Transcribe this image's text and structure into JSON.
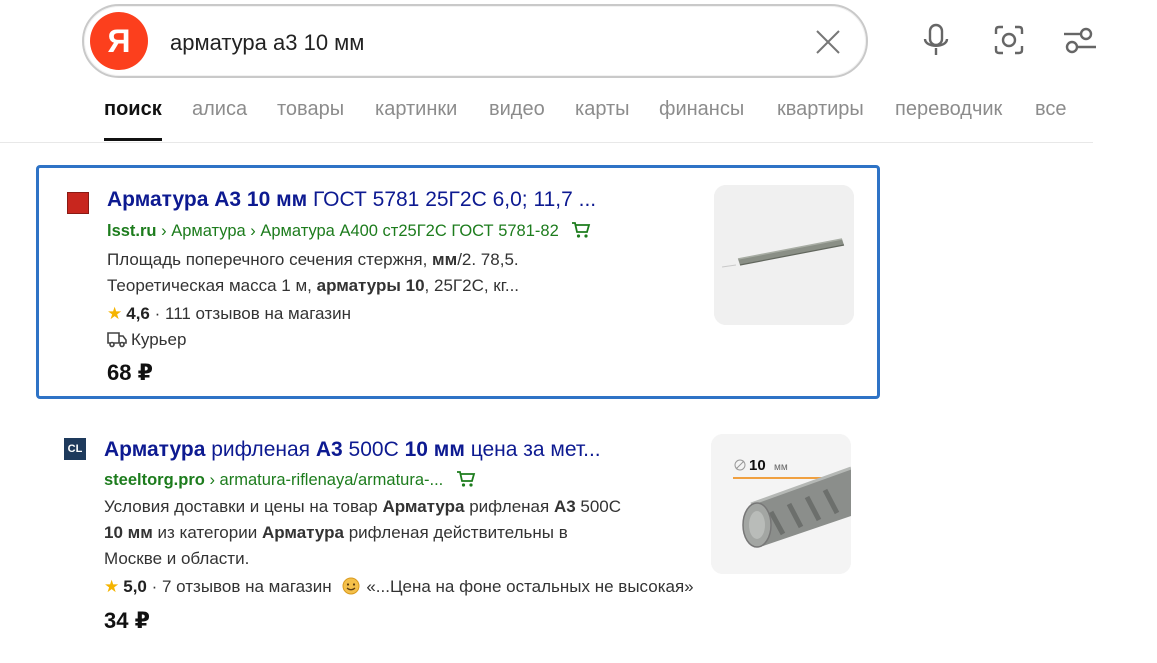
{
  "search": {
    "logo_letter": "Я",
    "query": "арматура а3 10 мм"
  },
  "tabs": [
    {
      "label": "поиск",
      "active": true
    },
    {
      "label": "алиса"
    },
    {
      "label": "товары"
    },
    {
      "label": "картинки"
    },
    {
      "label": "видео"
    },
    {
      "label": "карты"
    },
    {
      "label": "финансы"
    },
    {
      "label": "квартиры"
    },
    {
      "label": "переводчик"
    },
    {
      "label": "все"
    }
  ],
  "results": [
    {
      "title_parts": [
        {
          "text": "Арматура А3 10 мм",
          "bold": true
        },
        {
          "text": " ГОСТ 5781 25Г2С 6,0; 11,7 ...",
          "bold": false
        }
      ],
      "domain": "lsst.ru",
      "breadcrumbs": " › Арматура › Арматура А400 ст25Г2С ГОСТ 5781-82",
      "snippet_line1_parts": [
        {
          "text": "Площадь поперечного сечения стержня, ",
          "bold": false
        },
        {
          "text": "мм",
          "bold": true
        },
        {
          "text": "/2. 78,5.",
          "bold": false
        }
      ],
      "snippet_line2_parts": [
        {
          "text": "Теоретическая масса 1 м, ",
          "bold": false
        },
        {
          "text": "арматуры 10",
          "bold": true
        },
        {
          "text": ", 25Г2С, кг...",
          "bold": false
        }
      ],
      "rating": "4,6",
      "reviews": " · 111 отзывов на магазин",
      "delivery": "Курьер",
      "price": "68 ₽"
    },
    {
      "title_parts": [
        {
          "text": "Арматура",
          "bold": true
        },
        {
          "text": " рифленая ",
          "bold": false
        },
        {
          "text": "А3",
          "bold": true
        },
        {
          "text": " 500С ",
          "bold": false
        },
        {
          "text": "10 мм",
          "bold": true
        },
        {
          "text": " цена за мет...",
          "bold": false
        }
      ],
      "favicon_text": "CL",
      "domain": "steeltorg.pro",
      "breadcrumbs": " › armatura-riflenaya/armatura-...",
      "snippet_lines": [
        [
          {
            "text": "Условия доставки и цены на товар ",
            "bold": false
          },
          {
            "text": "Арматура",
            "bold": true
          },
          {
            "text": " рифленая ",
            "bold": false
          },
          {
            "text": "А3",
            "bold": true
          },
          {
            "text": " 500С",
            "bold": false
          }
        ],
        [
          {
            "text": "10 мм",
            "bold": true
          },
          {
            "text": " из категории ",
            "bold": false
          },
          {
            "text": "Арматура",
            "bold": true
          },
          {
            "text": " рифленая действительны в",
            "bold": false
          }
        ],
        [
          {
            "text": "Москве и области.",
            "bold": false
          }
        ]
      ],
      "rating": "5,0",
      "reviews": " · 7 отзывов на магазин",
      "review_quote": "«...Цена на фоне остальных не высокая»",
      "thumb_label": "10",
      "thumb_unit": "мм",
      "price": "34 ₽"
    }
  ]
}
